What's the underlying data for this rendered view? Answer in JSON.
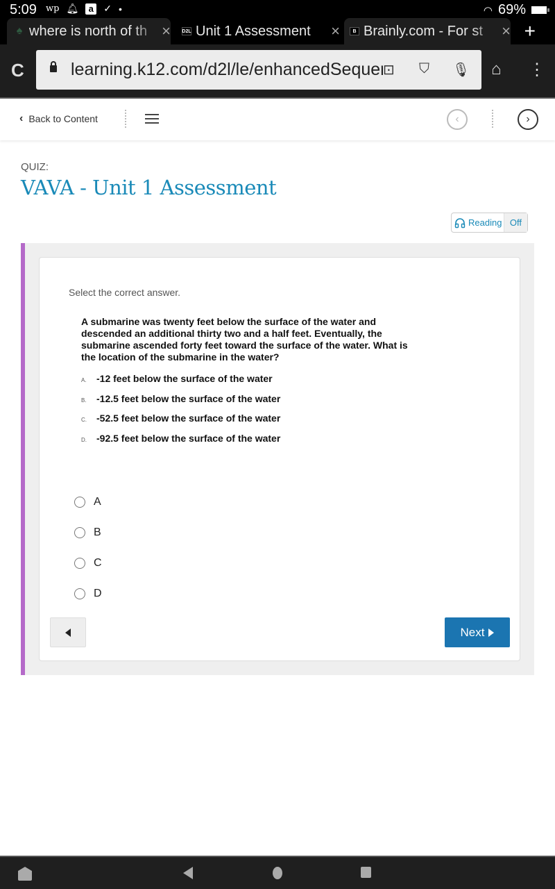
{
  "status_bar": {
    "time": "5:09",
    "notifications": [
      "washington-post-icon",
      "bell-icon",
      "amazon-icon",
      "download-done-icon",
      "dot-icon"
    ],
    "wifi": "wifi-icon",
    "battery": "69%"
  },
  "tabs": [
    {
      "title": "where is north of th",
      "favicon": "spade",
      "active": true
    },
    {
      "title": "Unit 1 Assessment",
      "favicon": "D2L",
      "active": false
    },
    {
      "title": "Brainly.com - For st",
      "favicon": "B",
      "active": true
    }
  ],
  "new_tab_label": "+",
  "toolbar": {
    "url": "learning.k12.com/d2l/le/enhancedSequer"
  },
  "page_header": {
    "back_label": "Back to Content"
  },
  "quiz": {
    "label": "QUIZ:",
    "title": "VAVA - Unit 1 Assessment"
  },
  "reading": {
    "label": "Reading",
    "state": "Off"
  },
  "question": {
    "instruction": "Select the correct answer.",
    "text": "A submarine was twenty feet below the surface of the water and descended an additional thirty two and a half feet.  Eventually, the submarine ascended forty feet toward the surface of the water.  What is the location of the submarine in the water?",
    "choices": [
      {
        "letter": "A.",
        "text": "-12 feet below the surface of the water"
      },
      {
        "letter": "B.",
        "text": "-12.5 feet below the surface of the water"
      },
      {
        "letter": "C.",
        "text": "-52.5 feet below the surface of the water"
      },
      {
        "letter": "D.",
        "text": "-92.5 feet below the surface of the water"
      }
    ],
    "options": [
      {
        "label": "A",
        "selected": false
      },
      {
        "label": "B",
        "selected": false
      },
      {
        "label": "C",
        "selected": false
      },
      {
        "label": "D",
        "selected": false
      }
    ]
  },
  "navigation": {
    "next_label": "Next"
  },
  "colors": {
    "accent": "#1a8ab8",
    "next_button": "#1b75b1",
    "side_bar": "#b56ac9"
  }
}
